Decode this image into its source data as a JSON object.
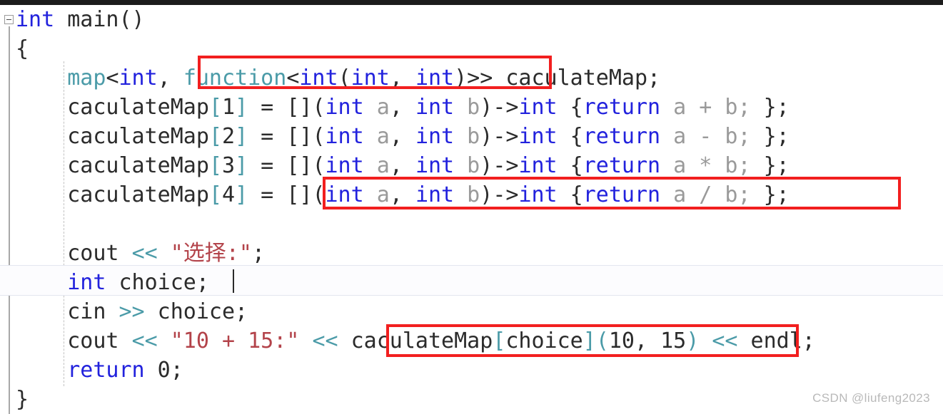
{
  "editor": {
    "language": "cpp",
    "fold_icon": "collapse-minus-icon",
    "caret_line": 9,
    "colors": {
      "background": "#ffffff",
      "keyword": "#2222dd",
      "type": "#4b9ba8",
      "plain": "#2b2b2b",
      "variable": "#9a9a9a",
      "operator": "#4b9ba8",
      "string": "#b3434a",
      "annotation": "#f21f1f",
      "gutter_line": "#a8a8a8",
      "indent_guide": "#c2c2c2",
      "current_line": "#e3e6ef",
      "top_strip": "#1c1c1c",
      "watermark": "#b9b9b9"
    }
  },
  "code": {
    "line1": {
      "t1": "int",
      "t2": " main()"
    },
    "line2": {
      "t1": "{"
    },
    "line3": {
      "indent": "    ",
      "t1": "map",
      "t2": "<",
      "t3": "int",
      "t4": ", ",
      "t5": "function",
      "t6": "<",
      "t7": "int",
      "t8": "(",
      "t9": "int",
      "t10": ", ",
      "t11": "int",
      "t12": ")>",
      "t13": "> caculateMap;"
    },
    "line4": {
      "indent": "    ",
      "name": "caculateMap",
      "idx_open": "[",
      "index": "1",
      "idx_close": "]",
      "assign": " = ",
      "capture": "[]",
      "paren_open": "(",
      "k1": "int",
      "v1": " a",
      "comma": ", ",
      "k2": "int",
      "v2": " b",
      "paren_close": ")",
      "arrow": "->",
      "ret_type": "int",
      "brace_open": " {",
      "kw_return": "return",
      "expr": " a + b; ",
      "brace_close": "};"
    },
    "line5": {
      "indent": "    ",
      "name": "caculateMap",
      "idx_open": "[",
      "index": "2",
      "idx_close": "]",
      "assign": " = ",
      "capture": "[]",
      "paren_open": "(",
      "k1": "int",
      "v1": " a",
      "comma": ", ",
      "k2": "int",
      "v2": " b",
      "paren_close": ")",
      "arrow": "->",
      "ret_type": "int",
      "brace_open": " {",
      "kw_return": "return",
      "expr": " a - b; ",
      "brace_close": "};"
    },
    "line6": {
      "indent": "    ",
      "name": "caculateMap",
      "idx_open": "[",
      "index": "3",
      "idx_close": "]",
      "assign": " = ",
      "capture": "[]",
      "paren_open": "(",
      "k1": "int",
      "v1": " a",
      "comma": ", ",
      "k2": "int",
      "v2": " b",
      "paren_close": ")",
      "arrow": "->",
      "ret_type": "int",
      "brace_open": " {",
      "kw_return": "return",
      "expr": " a * b; ",
      "brace_close": "};"
    },
    "line7": {
      "indent": "    ",
      "name": "caculateMap",
      "idx_open": "[",
      "index": "4",
      "idx_close": "]",
      "assign": " = ",
      "capture": "[]",
      "paren_open": "(",
      "k1": "int",
      "v1": " a",
      "comma": ", ",
      "k2": "int",
      "v2": " b",
      "paren_close": ")",
      "arrow": "->",
      "ret_type": "int",
      "brace_open": " {",
      "kw_return": "return",
      "expr": " a / b; ",
      "brace_close": "};"
    },
    "line8": {
      "indent": "    ",
      "t1": "cout ",
      "t2": "<<",
      "t3": " ",
      "t4": "\"选择:\"",
      "t5": ";"
    },
    "line9": {
      "indent": "    ",
      "t1": "int",
      "t2": " choice;"
    },
    "line10": {
      "indent": "    ",
      "t1": "cin ",
      "t2": ">>",
      "t3": " choice;"
    },
    "line11": {
      "indent": "    ",
      "t1": "cout ",
      "t2": "<<",
      "t3": " ",
      "t4": "\"10 + 15:\"",
      "t5": " ",
      "t6": "<<",
      "t7": " caculateMap",
      "t8": "[",
      "t9": "choice",
      "t10": "]",
      "t11": "(",
      "t12": "10, 15",
      "t13": ")",
      "t14": " ",
      "t15": "<<",
      "t16": " endl;"
    },
    "line12": {
      "indent": "    ",
      "t1": "return",
      "t2": " 0;"
    },
    "line13": {
      "t1": "}"
    }
  },
  "annotations": {
    "box1": "function<int(int, int)>",
    "box2": "[](int a, int b)->int {return a / b; };",
    "box3": "caculateMap[choice](10, 15)"
  },
  "watermark": {
    "text": "CSDN @liufeng2023"
  }
}
